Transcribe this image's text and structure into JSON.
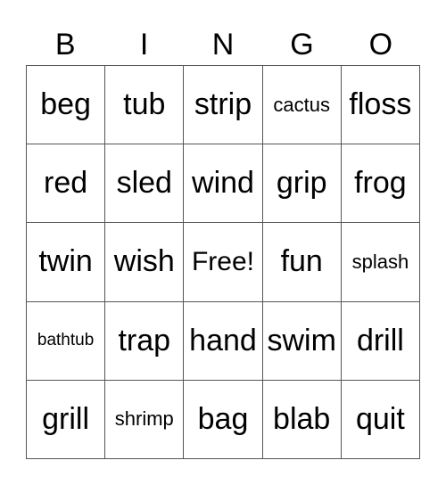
{
  "header": [
    "B",
    "I",
    "N",
    "G",
    "O"
  ],
  "cells": [
    [
      "beg",
      "tub",
      "strip",
      "cactus",
      "floss"
    ],
    [
      "red",
      "sled",
      "wind",
      "grip",
      "frog"
    ],
    [
      "twin",
      "wish",
      "Free!",
      "fun",
      "splash"
    ],
    [
      "bathtub",
      "trap",
      "hand",
      "swim",
      "drill"
    ],
    [
      "grill",
      "shrimp",
      "bag",
      "blab",
      "quit"
    ]
  ]
}
